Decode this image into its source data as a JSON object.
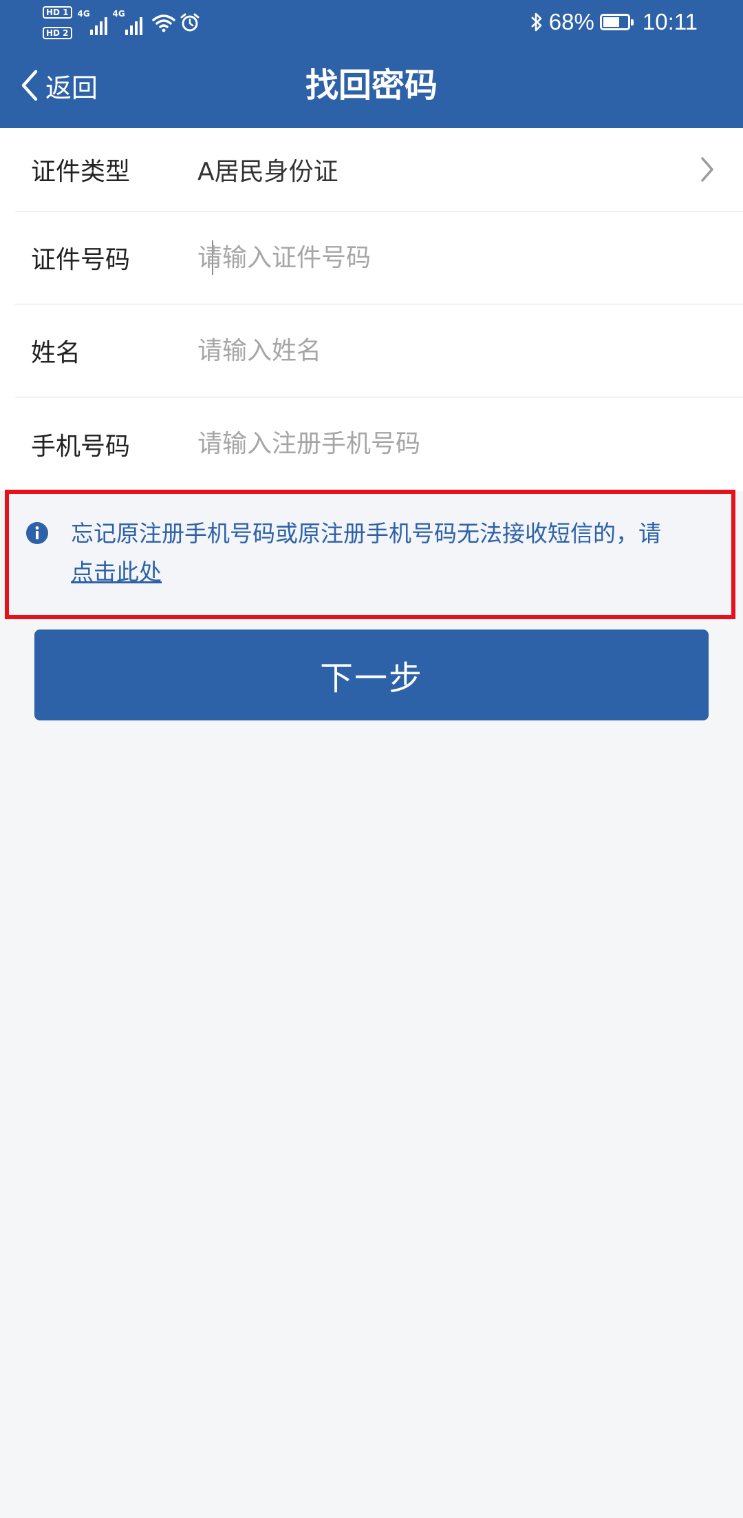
{
  "status_bar": {
    "sim1": "HD 1",
    "sim2": "HD 2",
    "net1": "4G",
    "net2": "4G",
    "battery_percent": "68%",
    "battery_level": 0.68,
    "time": "10:11",
    "icons": [
      "wifi-icon",
      "alarm-icon",
      "bluetooth-icon",
      "battery-charging-icon"
    ]
  },
  "nav": {
    "back_label": "返回",
    "title": "找回密码"
  },
  "form": {
    "id_type": {
      "label": "证件类型",
      "value": "A居民身份证"
    },
    "id_number": {
      "label": "证件号码",
      "placeholder": "请输入证件号码",
      "value": ""
    },
    "name": {
      "label": "姓名",
      "placeholder": "请输入姓名",
      "value": ""
    },
    "phone": {
      "label": "手机号码",
      "placeholder": "请输入注册手机号码",
      "value": ""
    }
  },
  "notice": {
    "text": "忘记原注册手机号码或原注册手机号码无法接收短信的，请",
    "link": "点击此处"
  },
  "next_button": {
    "label": "下一步"
  },
  "colors": {
    "brand": "#2d61a8",
    "highlight_border": "#e8101b",
    "background": "#f5f6f8"
  }
}
